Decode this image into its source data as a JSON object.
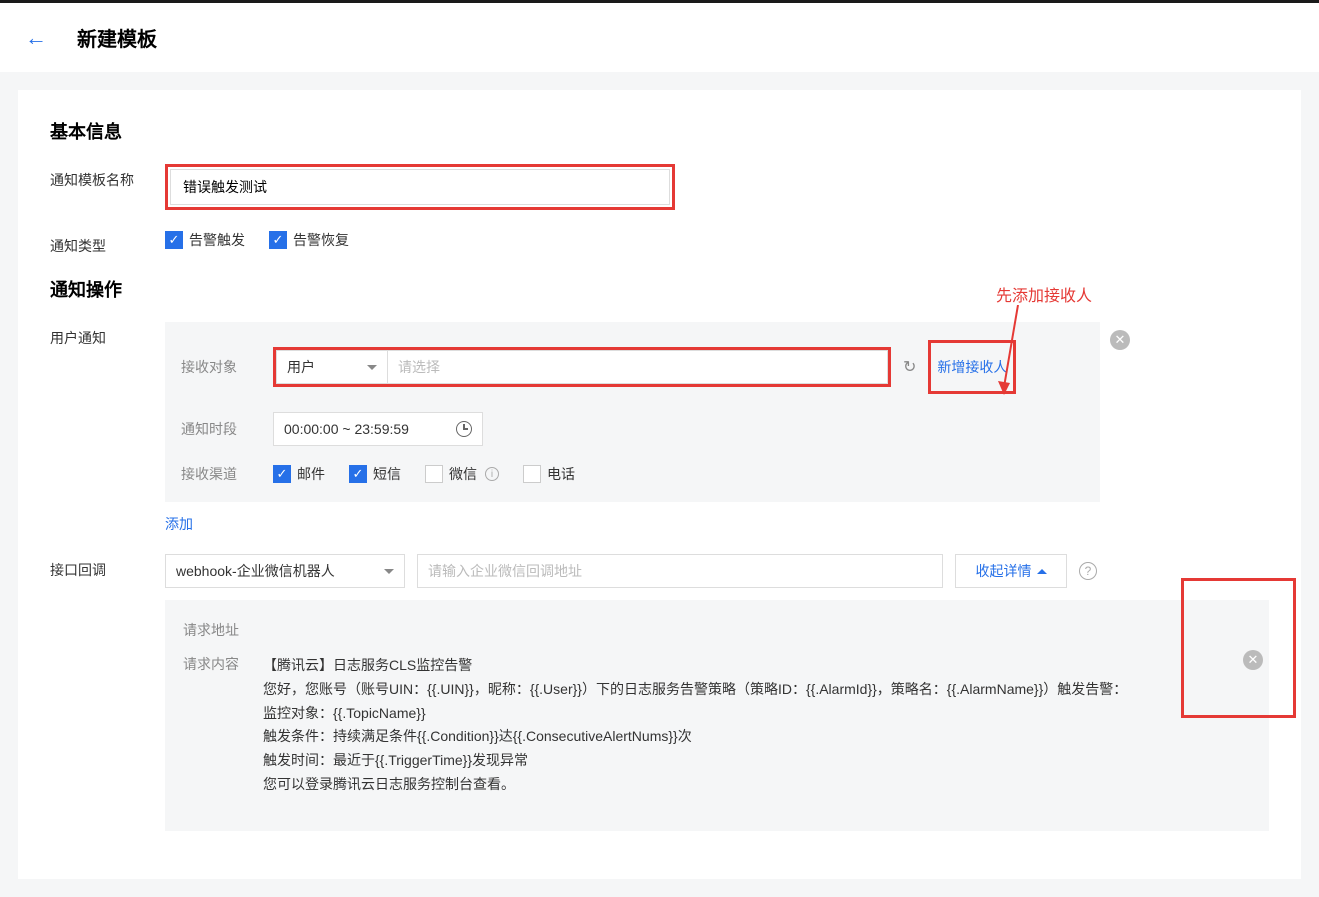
{
  "header": {
    "page_title": "新建模板"
  },
  "basic_info": {
    "section_title": "基本信息",
    "template_name_label": "通知模板名称",
    "template_name_value": "错误触发测试",
    "notif_type_label": "通知类型",
    "alarm_trigger": "告警触发",
    "alarm_recover": "告警恢复"
  },
  "notif_ops": {
    "section_title": "通知操作",
    "user_notif_label": "用户通知",
    "recipient_label": "接收对象",
    "recipient_type": "用户",
    "recipient_placeholder": "请选择",
    "add_recipient_link": "新增接收人",
    "time_period_label": "通知时段",
    "time_period_value": "00:00:00 ~ 23:59:59",
    "channel_label": "接收渠道",
    "channel_email": "邮件",
    "channel_sms": "短信",
    "channel_wechat": "微信",
    "channel_phone": "电话",
    "add_link": "添加"
  },
  "webhook": {
    "label": "接口回调",
    "type_value": "webhook-企业微信机器人",
    "url_placeholder": "请输入企业微信回调地址",
    "collapse_text": "收起详情",
    "request_url_label": "请求地址",
    "request_body_label": "请求内容",
    "body_line1": "【腾讯云】日志服务CLS监控告警",
    "body_line2": "您好，您账号（账号UIN：{{.UIN}}，昵称：{{.User}}）下的日志服务告警策略（策略ID：{{.AlarmId}}，策略名：{{.AlarmName}}）触发告警：",
    "body_line3": "监控对象：{{.TopicName}}",
    "body_line4": "触发条件：持续满足条件{{.Condition}}达{{.ConsecutiveAlertNums}}次",
    "body_line5": "触发时间：最近于{{.TriggerTime}}发现异常",
    "body_line6": "您可以登录腾讯云日志服务控制台查看。"
  },
  "annotations": {
    "add_recipient_first": "先添加接收人"
  }
}
